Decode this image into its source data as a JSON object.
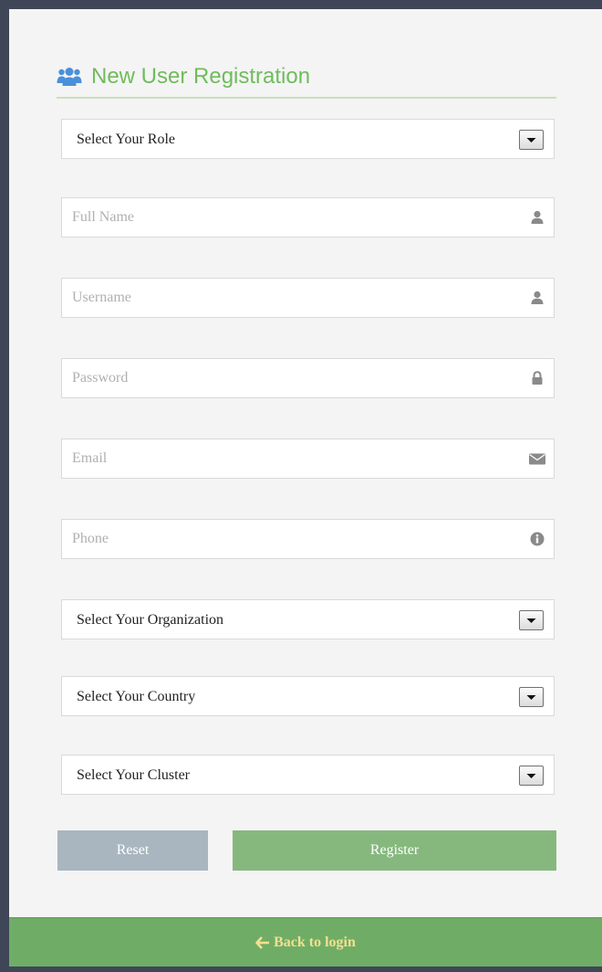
{
  "form": {
    "title": "New User Registration",
    "title_icon": "users-icon",
    "role_select": {
      "label": "Select Your Role"
    },
    "full_name": {
      "placeholder": "Full Name",
      "icon": "user-icon"
    },
    "username": {
      "placeholder": "Username",
      "icon": "user-icon"
    },
    "password": {
      "placeholder": "Password",
      "icon": "lock-icon"
    },
    "email": {
      "placeholder": "Email",
      "icon": "envelope-icon"
    },
    "phone": {
      "placeholder": "Phone",
      "icon": "info-icon"
    },
    "organization_select": {
      "label": "Select Your Organization"
    },
    "country_select": {
      "label": "Select Your Country"
    },
    "cluster_select": {
      "label": "Select Your Cluster"
    },
    "reset_label": "Reset",
    "register_label": "Register"
  },
  "footer": {
    "back_label": "Back to login",
    "back_icon": "arrow-left-icon"
  },
  "colors": {
    "title_green": "#6fbc5c",
    "title_icon_blue": "#4a90d9",
    "reset_button": "#a9b6bf",
    "register_button": "#86b87e",
    "footer_bar": "#6fad67",
    "footer_link": "#f2e08e",
    "frame": "#3f4657"
  }
}
